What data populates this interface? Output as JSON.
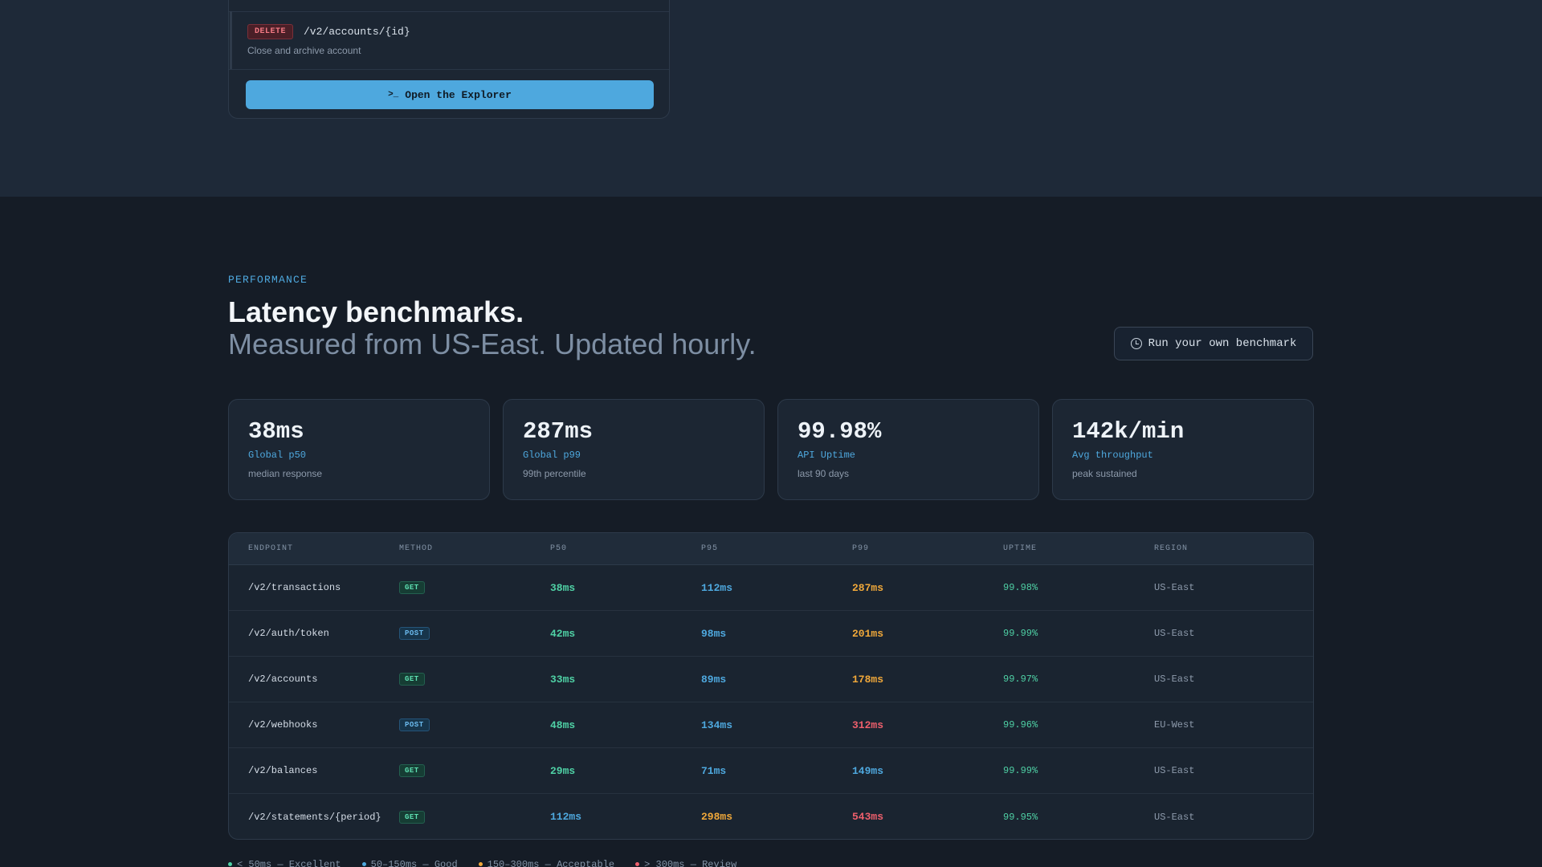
{
  "explorer": {
    "method": "DELETE",
    "path": "/v2/accounts/{id}",
    "description": "Close and archive account",
    "button_icon": ">_",
    "button_label": "Open the Explorer"
  },
  "performance": {
    "eyebrow": "PERFORMANCE",
    "title": "Latency benchmarks.",
    "subtitle": "Measured from US-East. Updated hourly.",
    "benchmark_button": "Run your own benchmark"
  },
  "stats": [
    {
      "value": "38ms",
      "label": "Global p50",
      "sub": "median response"
    },
    {
      "value": "287ms",
      "label": "Global p99",
      "sub": "99th percentile"
    },
    {
      "value": "99.98%",
      "label": "API Uptime",
      "sub": "last 90 days"
    },
    {
      "value": "142k/min",
      "label": "Avg throughput",
      "sub": "peak sustained"
    }
  ],
  "table": {
    "headers": [
      "ENDPOINT",
      "METHOD",
      "P50",
      "P95",
      "P99",
      "UPTIME",
      "REGION"
    ],
    "rows": [
      {
        "endpoint": "/v2/transactions",
        "method": "GET",
        "p50": "38ms",
        "p95": "112ms",
        "p99": "287ms",
        "uptime": "99.98%",
        "region": "US-East"
      },
      {
        "endpoint": "/v2/auth/token",
        "method": "POST",
        "p50": "42ms",
        "p95": "98ms",
        "p99": "201ms",
        "uptime": "99.99%",
        "region": "US-East"
      },
      {
        "endpoint": "/v2/accounts",
        "method": "GET",
        "p50": "33ms",
        "p95": "89ms",
        "p99": "178ms",
        "uptime": "99.97%",
        "region": "US-East"
      },
      {
        "endpoint": "/v2/webhooks",
        "method": "POST",
        "p50": "48ms",
        "p95": "134ms",
        "p99": "312ms",
        "uptime": "99.96%",
        "region": "EU-West"
      },
      {
        "endpoint": "/v2/balances",
        "method": "GET",
        "p50": "29ms",
        "p95": "71ms",
        "p99": "149ms",
        "uptime": "99.99%",
        "region": "US-East"
      },
      {
        "endpoint": "/v2/statements/{period}",
        "method": "GET",
        "p50": "112ms",
        "p95": "298ms",
        "p99": "543ms",
        "uptime": "99.95%",
        "region": "US-East"
      }
    ]
  },
  "legend": [
    {
      "label": "< 50ms — Excellent",
      "color": "#4fd1a5"
    },
    {
      "label": "50–150ms — Good",
      "color": "#4ea8de"
    },
    {
      "label": "150–300ms — Acceptable",
      "color": "#f0a83a"
    },
    {
      "label": "> 300ms — Review",
      "color": "#ee5f6c"
    }
  ],
  "colors": {
    "accent": "#4ea8de",
    "excellent": "#4fd1a5",
    "good": "#4ea8de",
    "acceptable": "#f0a83a",
    "review": "#ee5f6c"
  }
}
